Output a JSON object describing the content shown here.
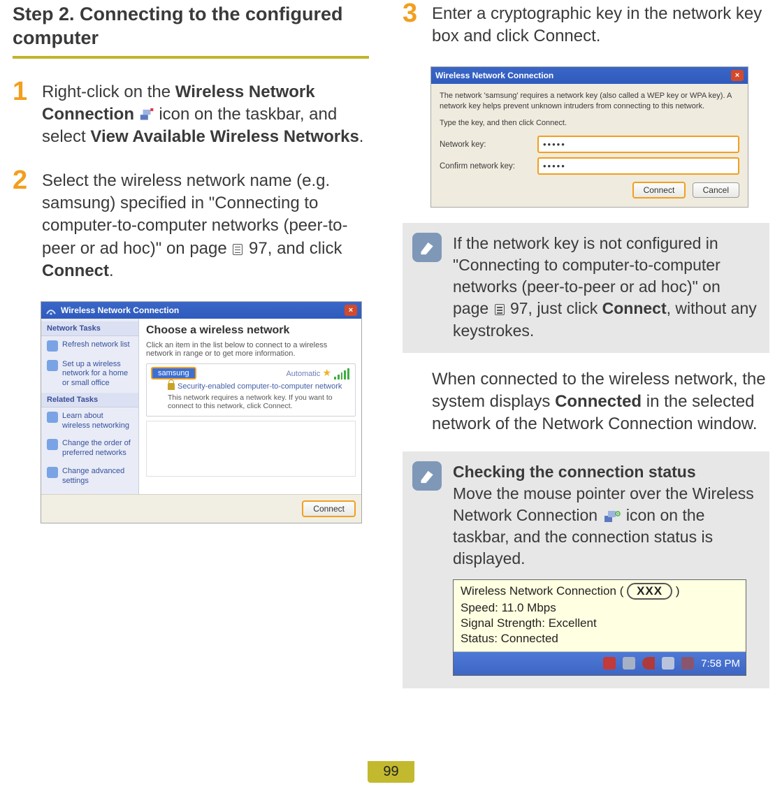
{
  "section_title": "Step 2. Connecting to the configured computer",
  "page_number": "99",
  "steps": {
    "one": {
      "num": "1",
      "pre": "Right-click on the ",
      "bold1": "Wireless Network Connection",
      "mid": " icon on the taskbar, and select ",
      "bold2": "View Available Wireless Networks",
      "post": "."
    },
    "two": {
      "num": "2",
      "pre": "Select the wireless network name (e.g. samsung) specified in \"Connecting to computer-to-computer networks (peer-to-peer or ad hoc)\" on page ",
      "pageref": "97",
      "mid": ", and click ",
      "bold": "Connect",
      "post": "."
    },
    "three": {
      "num": "3",
      "text": "Enter a cryptographic key in the network key box and click Connect."
    }
  },
  "screenshot_choose": {
    "title": "Wireless Network Connection",
    "side_head1": "Network Tasks",
    "side_item1": "Refresh network list",
    "side_item2": "Set up a wireless network for a home or small office",
    "side_head2": "Related Tasks",
    "side_item3": "Learn about wireless networking",
    "side_item4": "Change the order of preferred networks",
    "side_item5": "Change advanced settings",
    "main_heading": "Choose a wireless network",
    "main_hint": "Click an item in the list below to connect to a wireless network in range or to get more information.",
    "net_name": "samsung",
    "net_auto": "Automatic",
    "net_sec": "Security-enabled computer-to-computer network",
    "net_req": "This network requires a network key. If you want to connect to this network, click Connect.",
    "btn_connect": "Connect"
  },
  "screenshot_key": {
    "title": "Wireless Network Connection",
    "intro": "The network 'samsung' requires a network key (also called a WEP key or WPA key). A network key helps prevent unknown intruders from connecting to this network.",
    "type_hint": "Type the key, and then click Connect.",
    "label_key": "Network key:",
    "label_confirm": "Confirm network key:",
    "value_dots": "•••••",
    "btn_connect": "Connect",
    "btn_cancel": "Cancel"
  },
  "note1": {
    "pre": "If the network key is not configured in \"Connecting to computer-to-computer networks (peer-to-peer or ad hoc)\" on page ",
    "pageref": "97",
    "mid": ", just click ",
    "bold": "Connect",
    "post": ", without any keystrokes."
  },
  "connected_para": {
    "pre": "When connected to the wireless network, the system displays ",
    "bold": "Connected",
    "post": " in the selected network of the Network Connection window."
  },
  "note2": {
    "title": "Checking the connection status",
    "body_pre": "Move the mouse pointer over the Wireless Network Connection ",
    "body_post": " icon on the taskbar, and the connection status is displayed."
  },
  "tooltip": {
    "line1_pre": "Wireless Network Connection (",
    "line1_xxx": "XXX",
    "line1_post": ")",
    "line2": "Speed: 11.0 Mbps",
    "line3": "Signal Strength: Excellent",
    "line4": "Status:  Connected",
    "clock": "7:58 PM"
  }
}
